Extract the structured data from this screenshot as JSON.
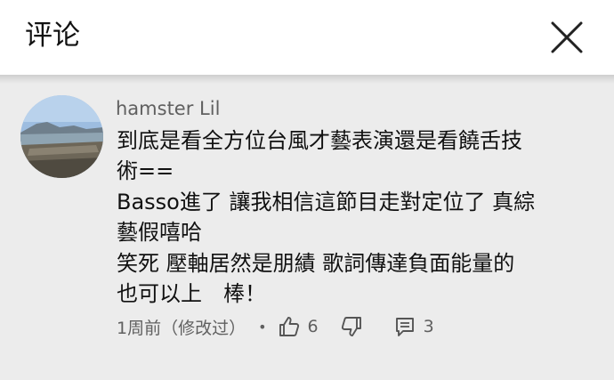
{
  "header": {
    "title": "评论",
    "close_icon": "close-icon"
  },
  "comment": {
    "author": "hamster Lil",
    "avatar_icon": "avatar-landscape",
    "lines": [
      "到底是看全方位台風才藝表演還是看饒舌技",
      "術==",
      "Basso進了 讓我相信這節目走對定位了 真綜",
      "藝假嘻哈",
      "笑死 壓軸居然是朋績 歌詞傳達負面能量的",
      "也可以上　棒！"
    ],
    "timestamp": "1周前（修改过）",
    "like_icon": "thumbs-up-icon",
    "like_count": "6",
    "dislike_icon": "thumbs-down-icon",
    "reply_icon": "reply-icon",
    "reply_count": "3"
  },
  "colors": {
    "header_bg": "#ffffff",
    "page_bg": "#ececec",
    "secondary_text": "#606060",
    "primary_text": "#111111"
  }
}
